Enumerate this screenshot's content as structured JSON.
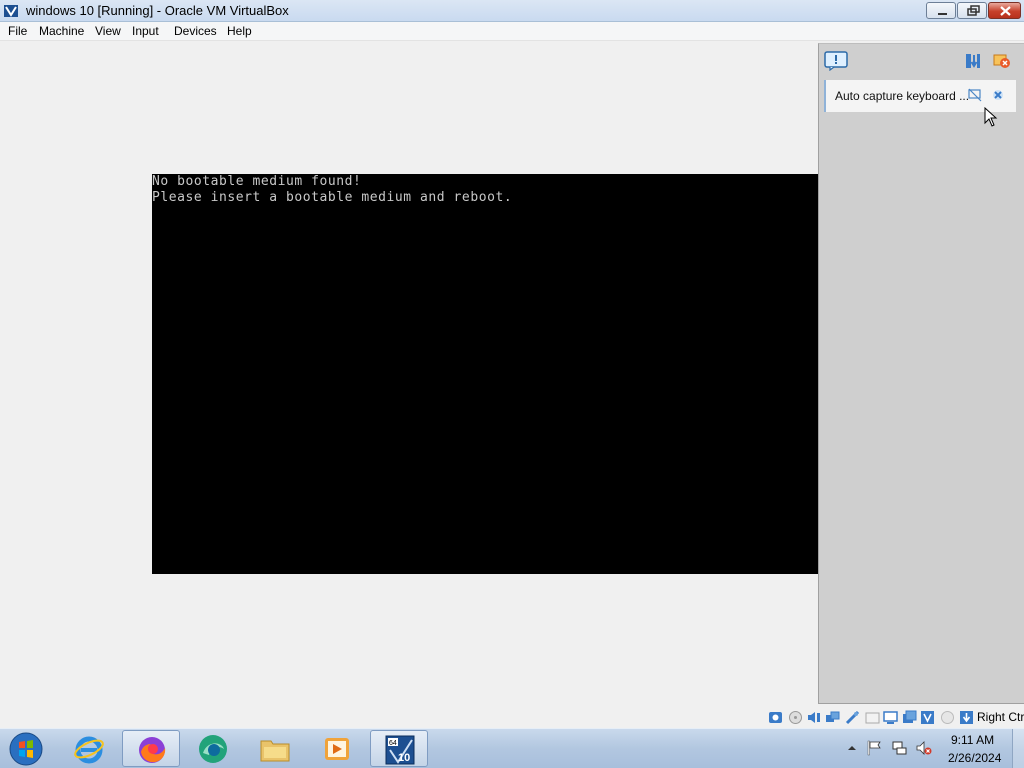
{
  "window": {
    "title": "windows 10 [Running] - Oracle VM VirtualBox"
  },
  "menu": {
    "items": [
      "File",
      "Machine",
      "View",
      "Input",
      "Devices",
      "Help"
    ]
  },
  "vm_console": {
    "lines": [
      "No bootable medium found!",
      "Please insert a bootable medium and reboot."
    ]
  },
  "notification_center": {
    "header_icon": "notification-icon",
    "tools": [
      "sort-icon",
      "close-all-icon"
    ],
    "message": "Auto capture keyboard ...",
    "message_actions": [
      "do-not-show-icon",
      "close-icon"
    ]
  },
  "status_bar": {
    "icons": [
      "hard-disk-icon",
      "optical-drive-icon",
      "audio-icon",
      "network-icon",
      "usb-icon",
      "shared-folders-icon",
      "display-icon",
      "video-capture-icon",
      "virtualization-icon",
      "mouse-integration-icon",
      "keyboard-icon"
    ],
    "host_key": "Right Ctrl"
  },
  "taskbar": {
    "apps": [
      "internet-explorer-icon",
      "firefox-icon",
      "browser-icon",
      "file-explorer-icon",
      "media-player-icon",
      "virtualbox-vm-icon"
    ],
    "tray_icons": [
      "show-hidden-icons",
      "action-center-flag-icon",
      "network-icon",
      "volume-muted-icon"
    ],
    "clock": {
      "time": "9:11 AM",
      "date": "2/26/2024"
    }
  },
  "colors": {
    "console_bg": "#000000",
    "console_text": "#c8c8c8",
    "taskbar": "#b2c7e0"
  }
}
